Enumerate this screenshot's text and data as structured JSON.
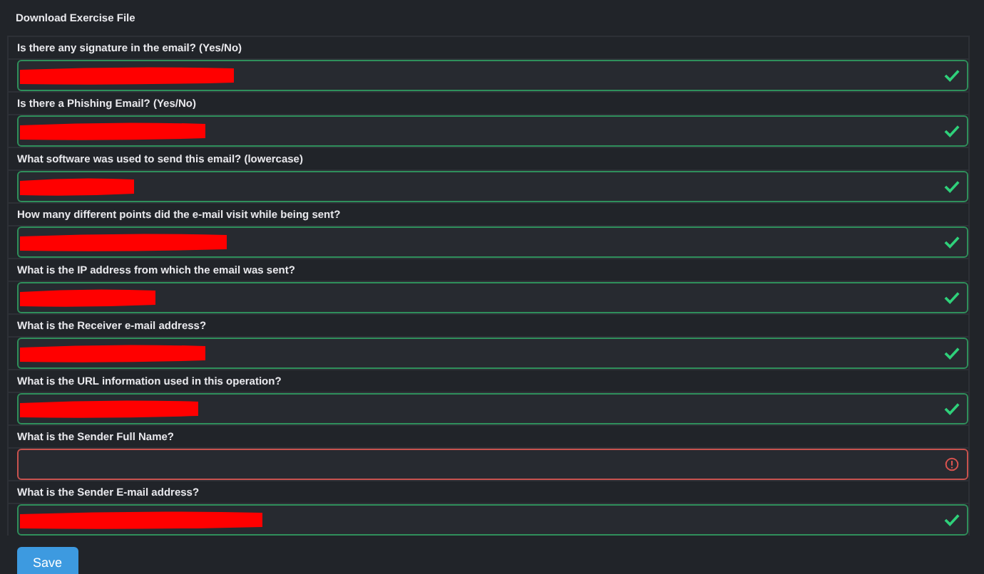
{
  "title": "Download Exercise File",
  "questions": [
    {
      "label": "Is there any signature in the email? (Yes/No)",
      "valid": true,
      "redacted": true
    },
    {
      "label": "Is there a Phishing Email? (Yes/No)",
      "valid": true,
      "redacted": true
    },
    {
      "label": "What software was used to send this email? (lowercase)",
      "valid": true,
      "redacted": true
    },
    {
      "label": "How many different points did the e-mail visit while being sent?",
      "valid": true,
      "redacted": true
    },
    {
      "label": "What is the IP address from which the email was sent?",
      "valid": true,
      "redacted": true
    },
    {
      "label": "What is the Receiver e-mail address?",
      "valid": true,
      "redacted": true
    },
    {
      "label": "What is the URL information used in this operation?",
      "valid": true,
      "redacted": true
    },
    {
      "label": "What is the Sender Full Name?",
      "valid": false,
      "redacted": false
    },
    {
      "label": "What is the Sender E-mail address?",
      "valid": true,
      "redacted": true
    }
  ],
  "save_button": "Save"
}
